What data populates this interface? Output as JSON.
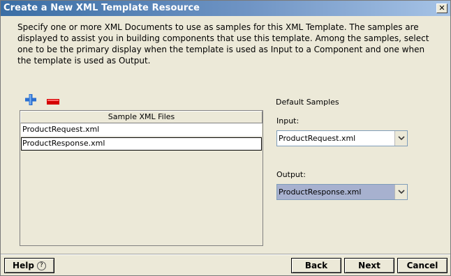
{
  "window": {
    "title": "Create a New XML Template Resource",
    "close_label": "✕"
  },
  "description": "Specify one or more XML Documents to use as samples for this XML Template. The samples are displayed to assist you in building components that use this template. Among the samples, select one to be the primary display when the template is used as Input to a Component and one when the template is used as Output.",
  "toolbar": {
    "add_icon": "plus-icon",
    "remove_icon": "minus-icon"
  },
  "table": {
    "header": "Sample XML Files",
    "rows": [
      "ProductRequest.xml",
      "ProductResponse.xml"
    ]
  },
  "defaults": {
    "heading": "Default Samples",
    "input_label": "Input:",
    "input_value": "ProductRequest.xml",
    "output_label": "Output:",
    "output_value": "ProductResponse.xml"
  },
  "buttons": {
    "help": "Help",
    "help_icon": "?",
    "back": "Back",
    "next": "Next",
    "cancel": "Cancel"
  },
  "colors": {
    "add_icon": "#2a6fd1",
    "remove_icon": "#d40000",
    "output_highlight": "#a7b1cf"
  }
}
